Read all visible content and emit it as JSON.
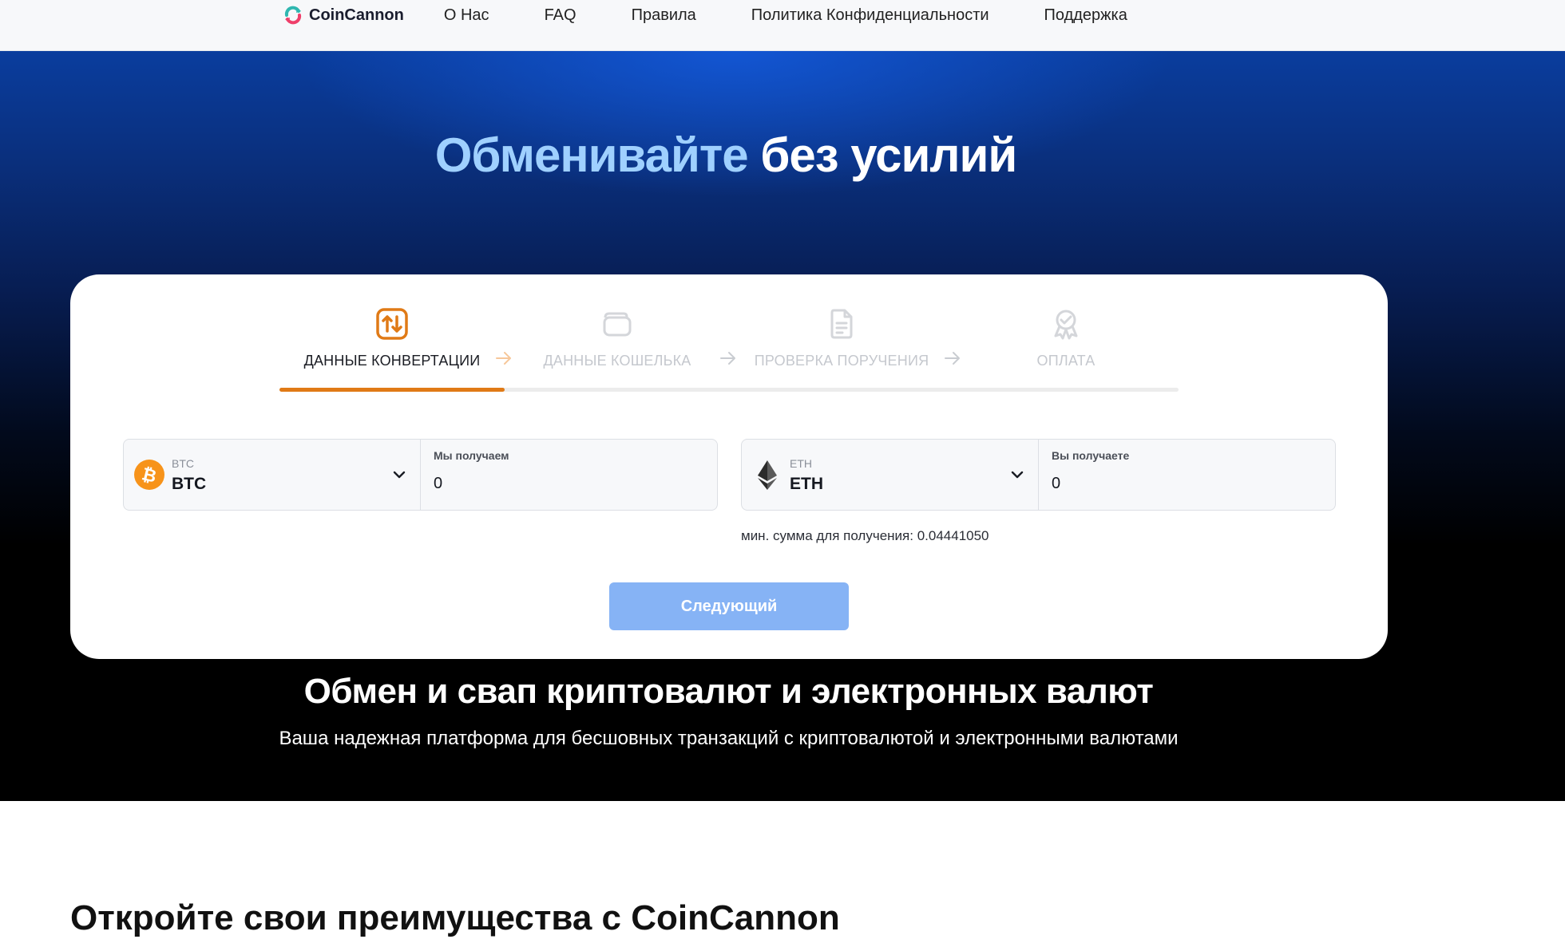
{
  "nav": {
    "brand": "CoinCannon",
    "links": [
      "О Нас",
      "FAQ",
      "Правила",
      "Политика Конфиденциальности",
      "Поддержка"
    ]
  },
  "hero": {
    "title_accent": "Обменивайте",
    "title_rest": "без усилий"
  },
  "stepper": {
    "steps": [
      {
        "label": "ДАННЫЕ КОНВЕРТАЦИИ",
        "icon": "exchange-arrows-icon",
        "active": true
      },
      {
        "label": "ДАННЫЕ КОШЕЛЬКА",
        "icon": "wallet-icon",
        "active": false
      },
      {
        "label": "ПРОВЕРКА ПОРУЧЕНИЯ",
        "icon": "document-icon",
        "active": false
      },
      {
        "label": "ОПЛАТА",
        "icon": "award-badge-icon",
        "active": false
      }
    ],
    "active_color": "#e07a16",
    "inactive_color": "#c5c8ce"
  },
  "exchange": {
    "from": {
      "coin_small": "BTC",
      "coin_big": "BTC",
      "icon": "bitcoin-icon",
      "amount_label": "Мы получаем",
      "amount_value": "0"
    },
    "to": {
      "coin_small": "ETH",
      "coin_big": "ETH",
      "icon": "ethereum-icon",
      "amount_label": "Вы получаете",
      "amount_value": "0"
    },
    "min_note": "мин. сумма для получения: 0.04441050",
    "next_label": "Следующий"
  },
  "section": {
    "title": "Обмен и свап криптовалют и электронных валют",
    "desc": "Ваша надежная платформа для бесшовных транзакций с криптовалютой и электронными валютами"
  },
  "benefits": {
    "title": "Откройте свои преимущества с CoinCannon"
  },
  "colors": {
    "brand_orange": "#e07a16",
    "button_blue": "#86b3f5",
    "hero_accent": "#9fd0ff",
    "bitcoin": "#f7931a"
  }
}
